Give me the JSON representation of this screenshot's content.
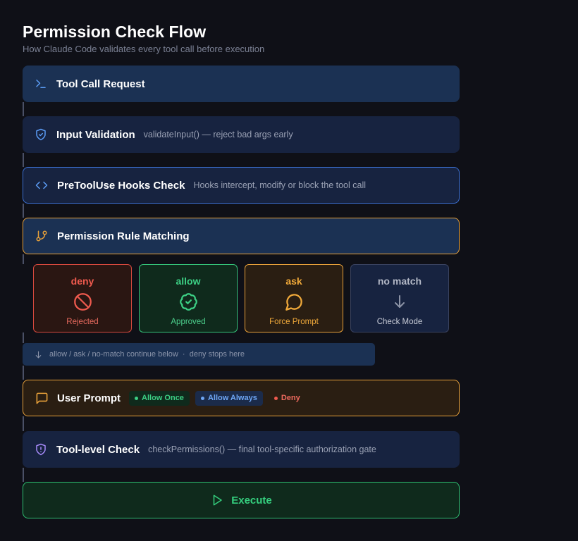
{
  "header": {
    "title": "Permission Check Flow",
    "subtitle": "How Claude Code validates every tool call before execution"
  },
  "steps": {
    "tool_call": {
      "name": "Tool Call Request",
      "icon": "terminal-icon",
      "color": "#5b9cf5"
    },
    "input_validation": {
      "name": "Input Validation",
      "desc": "validateInput() — reject bad args early",
      "icon": "shield-check-icon",
      "color": "#5b9cf5"
    },
    "hooks": {
      "name": "PreToolUse Hooks Check",
      "desc": "Hooks intercept, modify or block the tool call",
      "icon": "code-icon",
      "color": "#5b9cf5"
    },
    "permission": {
      "name": "Permission Rule Matching",
      "icon": "git-branch-icon",
      "color": "#e8a13a"
    },
    "user_prompt": {
      "name": "User Prompt",
      "icon": "message-square-icon",
      "color": "#e8a13a"
    },
    "tool_level": {
      "name": "Tool-level Check",
      "desc": "checkPermissions() — final tool-specific authorization gate",
      "icon": "shield-alert-icon",
      "color": "#a78bfa"
    },
    "execute": {
      "name": "Execute",
      "icon": "play-icon",
      "color": "#35d07f"
    }
  },
  "decisions": {
    "deny": {
      "title": "deny",
      "label": "Rejected",
      "icon": "ban-icon",
      "color": "#ef5a4e"
    },
    "allow": {
      "title": "allow",
      "label": "Approved",
      "icon": "badge-check-icon",
      "color": "#3ccf84"
    },
    "ask": {
      "title": "ask",
      "label": "Force Prompt",
      "icon": "message-circle-icon",
      "color": "#f0a93a"
    },
    "no_match": {
      "title": "no match",
      "label": "Check Mode",
      "icon": "arrow-down-icon",
      "color": "#8c93a6"
    }
  },
  "note": {
    "text": "allow / ask / no-match continue below  ·  deny stops here",
    "icon": "arrow-down-icon"
  },
  "prompt_options": {
    "allow_once": "Allow Once",
    "allow_always": "Allow Always",
    "deny": "Deny"
  }
}
